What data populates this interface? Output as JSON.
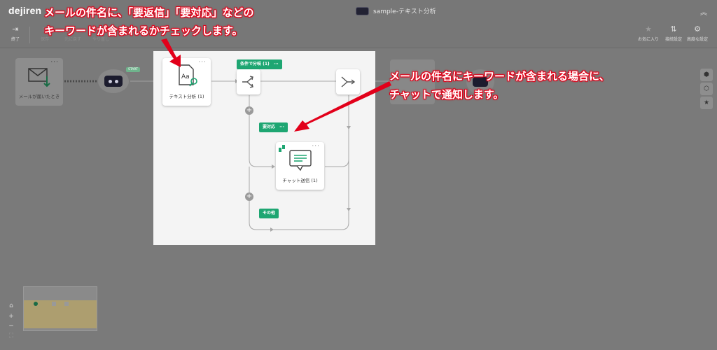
{
  "app": {
    "logo": "dejiren",
    "workflow_title": "sample-テキスト分析"
  },
  "toolbar": {
    "exit": "終了",
    "save": "保存",
    "redo": "元に戻す",
    "undo": "やり直し",
    "favorite": "お気に入り",
    "connect_settings": "接続設定",
    "advanced_settings": "高度な設定"
  },
  "nodes": {
    "mail_trigger": "メールが届いたとき",
    "start_badge": "START",
    "text_analysis": "テキスト分析 (1)",
    "chat_send": "チャット送信 (1)",
    "text_analysis_glyph": "Aa"
  },
  "tags": {
    "condition": "条件で分岐 (1)",
    "urgent": "要対応",
    "other": "その他",
    "menu": "···"
  },
  "annotations": {
    "top_line1": "メールの件名に、「要返信」「要対応」などの",
    "top_line2": "キーワードが含まれるかチェックします。",
    "right_line1": "メールの件名にキーワードが含まれる場合に、",
    "right_line2": "チャットで通知します。"
  },
  "zoom": {
    "reset": "⌂",
    "in": "+",
    "out": "−",
    "fit": "⛶"
  },
  "colors": {
    "accent": "#1ea672",
    "annotation": "#e2001a"
  }
}
